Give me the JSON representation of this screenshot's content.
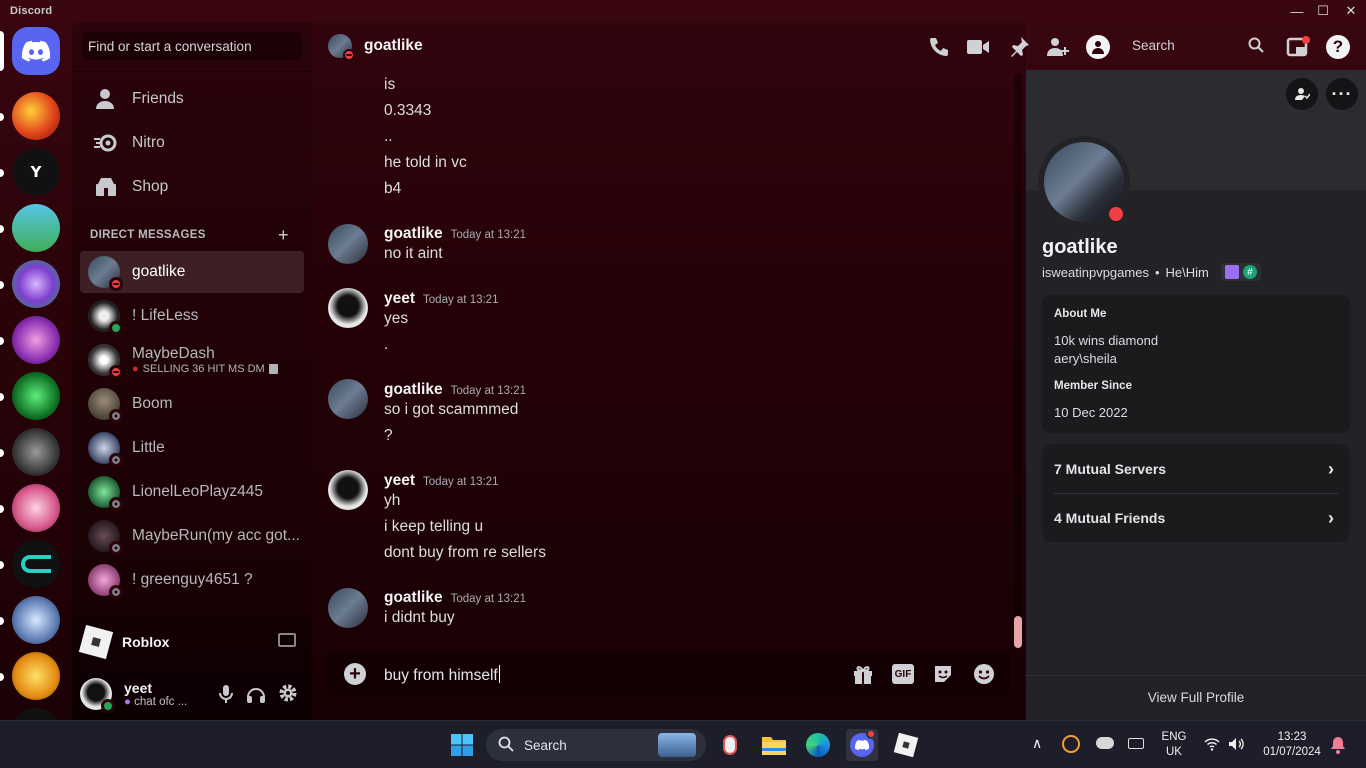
{
  "window": {
    "app_name": "Discord",
    "minimize": "—",
    "maximize": "☐",
    "close": "✕"
  },
  "sidebar": {
    "search_placeholder": "Find or start a conversation",
    "nav": [
      {
        "label": "Friends"
      },
      {
        "label": "Nitro"
      },
      {
        "label": "Shop"
      }
    ],
    "dm_header": "DIRECT MESSAGES",
    "dm_plus": "+",
    "dms": [
      {
        "name": "goatlike",
        "status": "dnd",
        "sub": ""
      },
      {
        "name": "! LifeLess",
        "status": "online",
        "sub": ""
      },
      {
        "name": "MaybeDash",
        "status": "dnd",
        "sub": "SELLING 36 HIT MS DM"
      },
      {
        "name": "Boom",
        "status": "offline",
        "sub": ""
      },
      {
        "name": "Little",
        "status": "offline",
        "sub": ""
      },
      {
        "name": "LionelLeoPlayz445",
        "status": "offline",
        "sub": ""
      },
      {
        "name": "MaybeRun(my acc got...",
        "status": "offline",
        "sub": ""
      },
      {
        "name": "! greenguy4651 ?",
        "status": "offline",
        "sub": ""
      }
    ],
    "activity": {
      "name": "Roblox"
    },
    "user": {
      "name": "yeet",
      "status_text": "chat ofc ..."
    }
  },
  "chat": {
    "channel_name": "goatlike",
    "search_label": "Search",
    "messages": [
      {
        "type": "cont",
        "text": "is"
      },
      {
        "type": "cont",
        "text": "0.3343"
      },
      {
        "type": "cont",
        "text": ".."
      },
      {
        "type": "cont",
        "text": "he told in vc"
      },
      {
        "type": "cont",
        "text": "b4"
      },
      {
        "type": "head",
        "author": "goatlike",
        "time": "Today at 13:21",
        "lines": [
          "no it aint"
        ]
      },
      {
        "type": "head",
        "author": "yeet",
        "time": "Today at 13:21",
        "lines": [
          "yes",
          "."
        ]
      },
      {
        "type": "head",
        "author": "goatlike",
        "time": "Today at 13:21",
        "lines": [
          "so i got scammmed",
          "?"
        ]
      },
      {
        "type": "head",
        "author": "yeet",
        "time": "Today at 13:21",
        "lines": [
          "yh",
          "i keep telling u",
          "dont buy from re sellers"
        ]
      },
      {
        "type": "head",
        "author": "goatlike",
        "time": "Today at 13:21",
        "lines": [
          "i didnt buy"
        ]
      }
    ],
    "composer_text": "buy from himself",
    "gif_label": "GIF"
  },
  "profile": {
    "display_name": "goatlike",
    "username": "isweatinpvpgames",
    "pronouns": "He\\Him",
    "about_title": "About Me",
    "about_lines": [
      "10k wins diamond",
      "aery\\sheila"
    ],
    "member_since_title": "Member Since",
    "member_since": "10 Dec 2022",
    "mutual_servers": "7 Mutual Servers",
    "mutual_friends": "4 Mutual Friends",
    "view_full": "View Full Profile"
  },
  "taskbar": {
    "search_label": "Search",
    "lang_1": "ENG",
    "lang_2": "UK",
    "time": "13:23",
    "date": "01/07/2024"
  },
  "colors": {
    "accent": "#5865f2",
    "dnd": "#f23f43",
    "online": "#23a55a"
  }
}
